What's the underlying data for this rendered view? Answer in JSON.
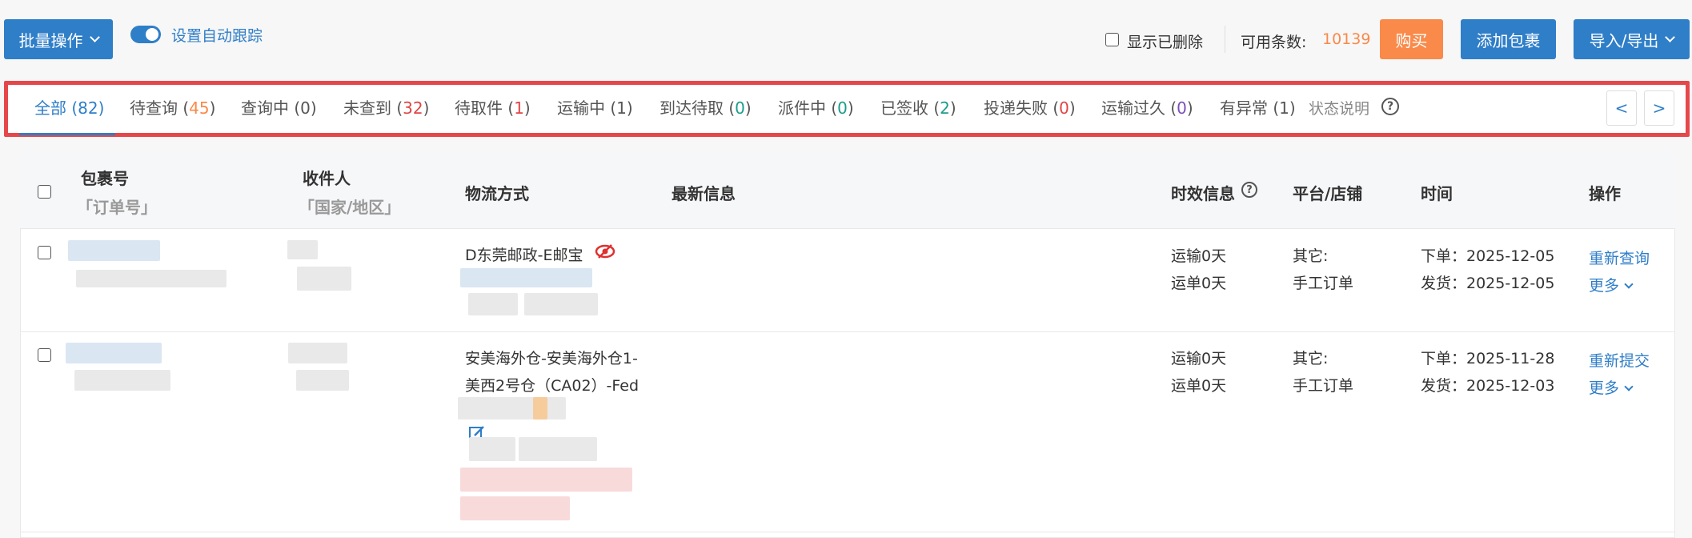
{
  "toolbar": {
    "batch_label": "批量操作",
    "auto_track_label": "设置自动跟踪",
    "show_deleted_label": "显示已删除",
    "available_label": "可用条数:",
    "available_count": "10139",
    "buy_label": "购买",
    "add_package_label": "添加包裹",
    "import_export_label": "导入/导出"
  },
  "tabs": [
    {
      "label": "全部",
      "count": "82",
      "count_color": "#2f7ec8"
    },
    {
      "label": "待查询",
      "count": "45",
      "count_color": "#f98a4a"
    },
    {
      "label": "查询中",
      "count": "0",
      "count_color": "#555555"
    },
    {
      "label": "未查到",
      "count": "32",
      "count_color": "#e14444"
    },
    {
      "label": "待取件",
      "count": "1",
      "count_color": "#e14444"
    },
    {
      "label": "运输中",
      "count": "1",
      "count_color": "#555555"
    },
    {
      "label": "到达待取",
      "count": "0",
      "count_color": "#1b9d8a"
    },
    {
      "label": "派件中",
      "count": "0",
      "count_color": "#1b9d8a"
    },
    {
      "label": "已签收",
      "count": "2",
      "count_color": "#1b9d8a"
    },
    {
      "label": "投递失败",
      "count": "0",
      "count_color": "#e14444"
    },
    {
      "label": "运输过久",
      "count": "0",
      "count_color": "#7b4fb8"
    },
    {
      "label": "有异常",
      "count": "1",
      "count_color": "#555555"
    }
  ],
  "status_help_label": "状态说明",
  "pager": {
    "prev": "<",
    "next": ">"
  },
  "table": {
    "headers": {
      "package_no": "包裹号",
      "order_no": "「订单号」",
      "recipient": "收件人",
      "country": "「国家/地区」",
      "logistics": "物流方式",
      "latest_info": "最新信息",
      "timeliness": "时效信息",
      "platform": "平台/店铺",
      "time": "时间",
      "action": "操作"
    },
    "rows": [
      {
        "logistics": "D东莞邮政-E邮宝",
        "timeliness": [
          "运输0天",
          "运单0天"
        ],
        "platform": [
          "其它:",
          "手工订单"
        ],
        "order_time": "下单：2025-12-05",
        "ship_time": "发货：2025-12-05",
        "action": "重新查询",
        "more": "更多"
      },
      {
        "logistics_line1": "安美海外仓-安美海外仓1-",
        "logistics_line2": "美西2号仓（CA02）-Fed",
        "timeliness": [
          "运输0天",
          "运单0天"
        ],
        "platform": [
          "其它:",
          "手工订单"
        ],
        "order_time": "下单：2025-11-28",
        "ship_time": "发货：2025-12-03",
        "action": "重新提交",
        "more": "更多"
      }
    ]
  },
  "colors": {
    "primary": "#2f7ec8",
    "accent_orange": "#f98a4a",
    "highlight_border": "#e5474b"
  }
}
